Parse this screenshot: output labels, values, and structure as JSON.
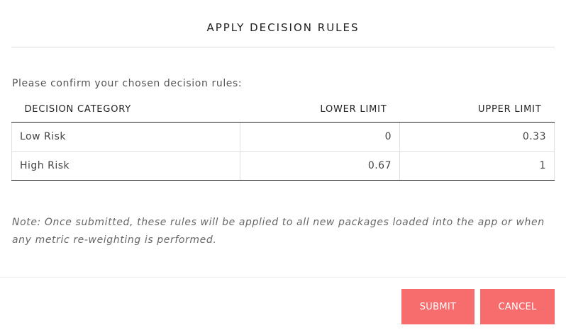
{
  "dialog": {
    "title": "APPLY DECISION RULES",
    "prompt": "Please confirm your chosen decision rules:",
    "note": "Note: Once submitted, these rules will be applied to all new packages loaded into the app or when any metric re-weighting is performed."
  },
  "table": {
    "headers": {
      "category": "DECISION CATEGORY",
      "lower": "LOWER LIMIT",
      "upper": "UPPER LIMIT"
    },
    "rows": [
      {
        "category": "Low Risk",
        "lower": "0",
        "upper": "0.33"
      },
      {
        "category": "High Risk",
        "lower": "0.67",
        "upper": "1"
      }
    ]
  },
  "buttons": {
    "submit": "SUBMIT",
    "cancel": "CANCEL"
  },
  "colors": {
    "button_background": "#f76c6c",
    "button_text": "#ffffff"
  }
}
